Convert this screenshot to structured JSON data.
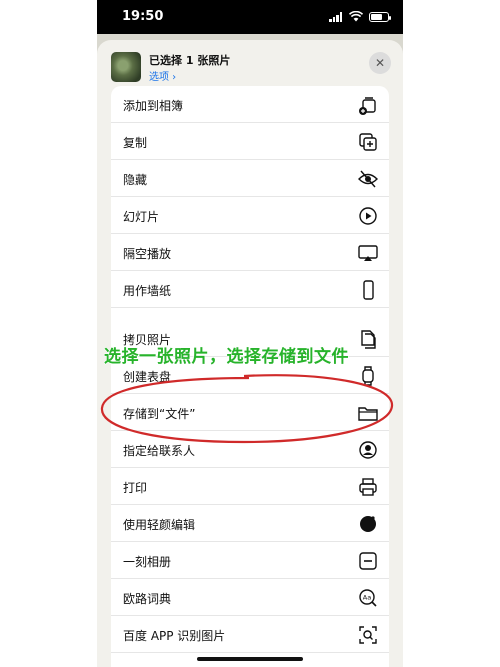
{
  "status_bar": {
    "time": "19:50"
  },
  "header": {
    "title": "已选择 1 张照片",
    "subtitle": "选项 ›",
    "close": "✕"
  },
  "group1": [
    {
      "label": "添加到相簿",
      "icon": "add-album-icon"
    },
    {
      "label": "复制",
      "icon": "duplicate-icon"
    },
    {
      "label": "隐藏",
      "icon": "eye-slash-icon"
    },
    {
      "label": "幻灯片",
      "icon": "play-circle-icon"
    },
    {
      "label": "隔空播放",
      "icon": "airplay-icon"
    },
    {
      "label": "用作墙纸",
      "icon": "phone-icon"
    }
  ],
  "group2": [
    {
      "label": "拷贝照片",
      "icon": "copy-photo-icon"
    },
    {
      "label": "创建表盘",
      "icon": "watch-icon"
    },
    {
      "label": "存储到“文件”",
      "icon": "folder-icon"
    },
    {
      "label": "指定给联系人",
      "icon": "contact-icon"
    },
    {
      "label": "打印",
      "icon": "printer-icon"
    },
    {
      "label": "使用轻颜编辑",
      "icon": "app-circle-icon"
    },
    {
      "label": "一刻相册",
      "icon": "minus-box-icon"
    },
    {
      "label": "欧路词典",
      "icon": "dictionary-icon"
    },
    {
      "label": "百度 APP 识别图片",
      "icon": "scan-icon"
    }
  ],
  "annotation": {
    "text": "选择一张照片，选择存储到文件",
    "color": "#27b32b",
    "circle_color": "#d02a2a"
  }
}
